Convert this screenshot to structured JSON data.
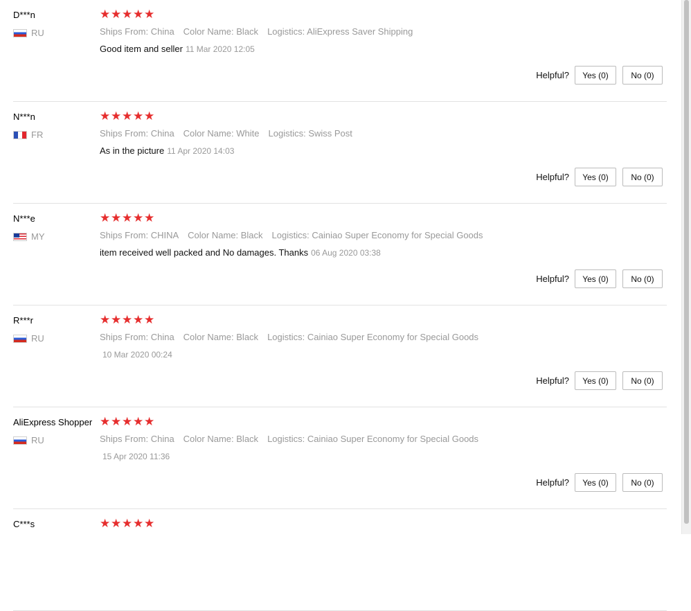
{
  "reviews": [
    {
      "user": "D***n",
      "country": "RU",
      "rating": 5,
      "attrs": [
        {
          "key": "Ships From:",
          "value": "China"
        },
        {
          "key": "Color Name:",
          "value": "Black"
        },
        {
          "key": "Logistics:",
          "value": "AliExpress Saver Shipping"
        }
      ],
      "comment": "Good item and seller",
      "date": "11 Mar 2020 12:05",
      "helpful_label": "Helpful?",
      "yes_label": "Yes (0)",
      "no_label": "No (0)"
    },
    {
      "user": "N***n",
      "country": "FR",
      "rating": 5,
      "attrs": [
        {
          "key": "Ships From:",
          "value": "China"
        },
        {
          "key": "Color Name:",
          "value": "White"
        },
        {
          "key": "Logistics:",
          "value": "Swiss Post"
        }
      ],
      "comment": "As in the picture",
      "date": "11 Apr 2020 14:03",
      "helpful_label": "Helpful?",
      "yes_label": "Yes (0)",
      "no_label": "No (0)"
    },
    {
      "user": "N***e",
      "country": "MY",
      "rating": 5,
      "attrs": [
        {
          "key": "Ships From:",
          "value": "CHINA"
        },
        {
          "key": "Color Name:",
          "value": "Black"
        },
        {
          "key": "Logistics:",
          "value": "Cainiao Super Economy for Special Goods"
        }
      ],
      "comment": "item received well packed and No damages. Thanks",
      "date": "06 Aug 2020 03:38",
      "helpful_label": "Helpful?",
      "yes_label": "Yes (0)",
      "no_label": "No (0)"
    },
    {
      "user": "R***r",
      "country": "RU",
      "rating": 5,
      "attrs": [
        {
          "key": "Ships From:",
          "value": "China"
        },
        {
          "key": "Color Name:",
          "value": "Black"
        },
        {
          "key": "Logistics:",
          "value": "Cainiao Super Economy for Special Goods"
        }
      ],
      "comment": "",
      "date": "10 Mar 2020 00:24",
      "helpful_label": "Helpful?",
      "yes_label": "Yes (0)",
      "no_label": "No (0)"
    },
    {
      "user": "AliExpress Shopper",
      "country": "RU",
      "rating": 5,
      "attrs": [
        {
          "key": "Ships From:",
          "value": "China"
        },
        {
          "key": "Color Name:",
          "value": "Black"
        },
        {
          "key": "Logistics:",
          "value": "Cainiao Super Economy for Special Goods"
        }
      ],
      "comment": "",
      "date": "15 Apr 2020 11:36",
      "helpful_label": "Helpful?",
      "yes_label": "Yes (0)",
      "no_label": "No (0)"
    },
    {
      "user": "C***s",
      "country": "",
      "rating": 5,
      "attrs": [],
      "comment": "",
      "date": "",
      "helpful_label": "",
      "yes_label": "",
      "no_label": ""
    }
  ],
  "colors": {
    "star": "#e62e2e",
    "muted_text": "#999999",
    "divider": "#e2e2e2"
  },
  "icons": {
    "star": "star-icon",
    "flag_prefix": "flag-icon"
  }
}
